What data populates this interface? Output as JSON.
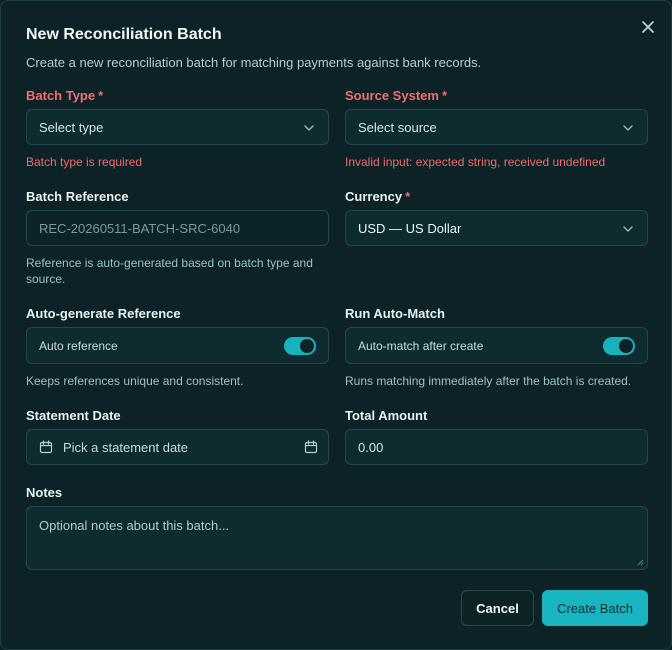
{
  "dialog": {
    "title": "New Reconciliation Batch",
    "subtitle": "Create a new reconciliation batch for matching payments against bank records.",
    "close_icon": "close-icon"
  },
  "batch_type": {
    "label": "Batch Type",
    "required_mark": "*",
    "placeholder": "Select type",
    "error": "Batch type is required"
  },
  "source_system": {
    "label": "Source System",
    "required_mark": "*",
    "placeholder": "Select source",
    "error": "Invalid input: expected string, received undefined"
  },
  "batch_reference": {
    "label": "Batch Reference",
    "value": "REC-20260511-BATCH-SRC-6040",
    "help": "Reference is auto-generated based on batch type and source."
  },
  "currency": {
    "label": "Currency",
    "required_mark": "*",
    "value": "USD — US Dollar"
  },
  "auto_reference": {
    "label": "Auto-generate Reference",
    "toggle_label": "Auto reference",
    "enabled": true,
    "help": "Keeps references unique and consistent."
  },
  "auto_match": {
    "label": "Run Auto-Match",
    "toggle_label": "Auto-match after create",
    "enabled": true,
    "help": "Runs matching immediately after the batch is created."
  },
  "statement_date": {
    "label": "Statement Date",
    "placeholder": "Pick a statement date"
  },
  "total_amount": {
    "label": "Total Amount",
    "value": "0.00"
  },
  "notes": {
    "label": "Notes",
    "placeholder": "Optional notes about this batch..."
  },
  "actions": {
    "cancel": "Cancel",
    "create": "Create Batch"
  },
  "colors": {
    "accent": "#18b4bf",
    "error": "#f07070",
    "background": "#0d2226"
  }
}
